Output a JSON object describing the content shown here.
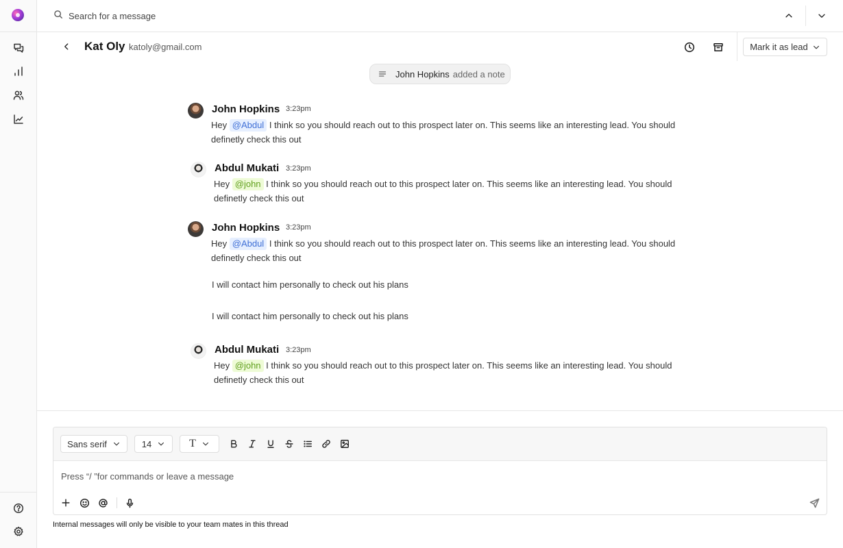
{
  "search": {
    "placeholder": "Search for a message"
  },
  "header": {
    "name": "Kat Oly",
    "email": "katoly@gmail.com",
    "lead_button": "Mark it as lead"
  },
  "note_pill": {
    "name": "John Hopkins",
    "action": "added a note"
  },
  "messages": [
    {
      "author": "John Hopkins",
      "time": "3:23pm",
      "greeting": "Hey",
      "mention": "@Abdul",
      "text": "I think so you should reach out to this prospect later on. This seems like an interesting lead. You should definetly check this out"
    },
    {
      "author": "Abdul Mukati",
      "time": "3:23pm",
      "greeting": "Hey",
      "mention": "@john",
      "text": "I think so you should reach out to this prospect later on. This seems like an interesting lead. You should definetly check this out"
    },
    {
      "author": "John Hopkins",
      "time": "3:23pm",
      "greeting": "Hey",
      "mention": "@Abdul",
      "text": "I think so you should reach out to this prospect later on. This seems like an interesting lead. You should definetly check this out",
      "extra": [
        "I will contact him personally to check out his plans",
        "I will contact him personally to check out his plans"
      ]
    },
    {
      "author": "Abdul Mukati",
      "time": "3:23pm",
      "greeting": "Hey",
      "mention": "@john",
      "text": "I think so you should reach out to this prospect later on. This seems like an interesting lead. You should definetly check this out"
    }
  ],
  "composer": {
    "font_family": "Sans serif",
    "font_size": "14",
    "text_style": "T",
    "placeholder": "Press “/ ”for commands or leave a message",
    "footnote": "Internal messages will only be visible to your team mates in this thread"
  },
  "icons": {
    "logo": "app-logo",
    "sidebar": [
      "chat-bubbles-icon",
      "bar-chart-icon",
      "users-icon",
      "line-chart-icon",
      "help-icon",
      "settings-icon"
    ],
    "toolbar": [
      "bold-icon",
      "italic-icon",
      "underline-icon",
      "strikethrough-icon",
      "list-icon",
      "link-icon",
      "image-icon"
    ]
  },
  "colors": {
    "mention_blue_bg": "#e6efff",
    "mention_blue_text": "#3f6fd6",
    "mention_green_bg": "#eefbd6",
    "mention_green_text": "#5f9e1b"
  }
}
